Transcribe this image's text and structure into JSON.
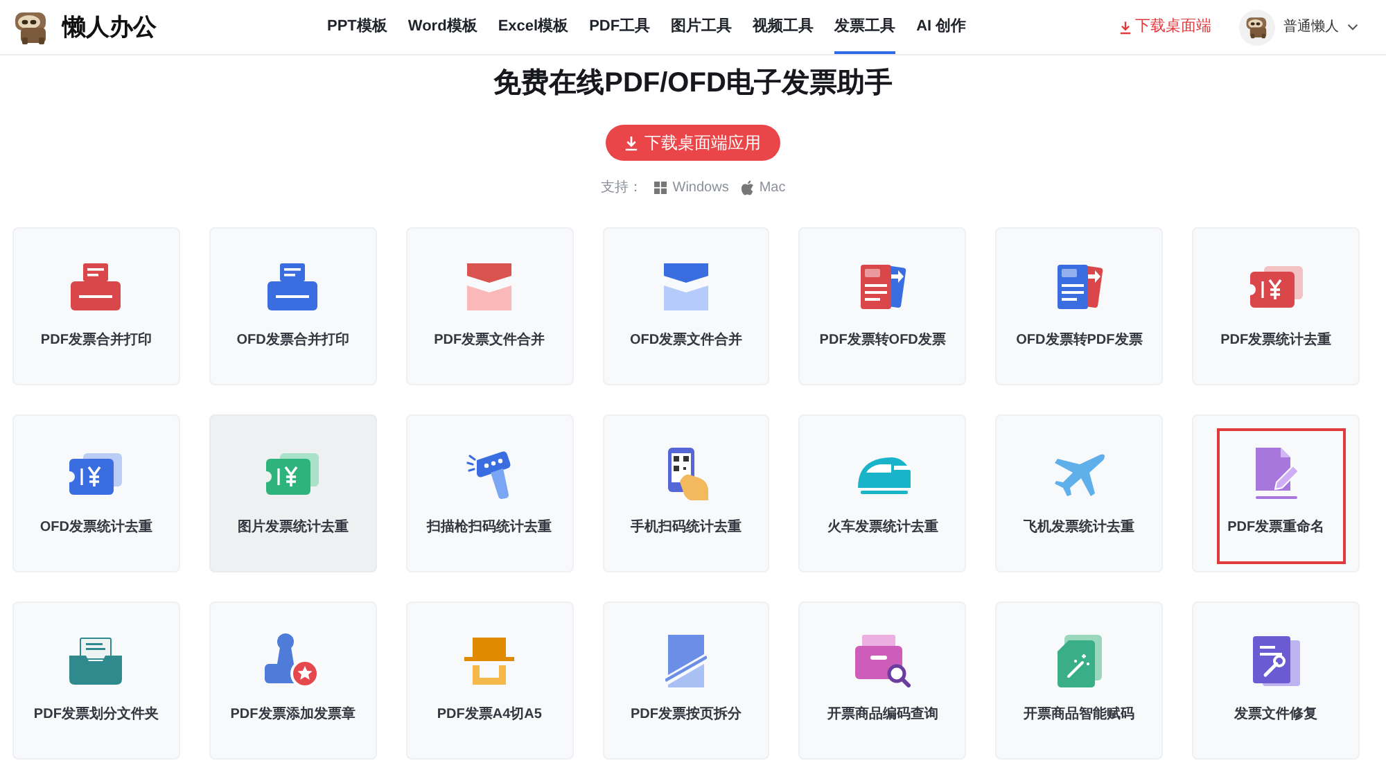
{
  "header": {
    "logo_text": "懒人办公",
    "nav": [
      {
        "label": "PPT模板",
        "selected": false
      },
      {
        "label": "Word模板",
        "selected": false
      },
      {
        "label": "Excel模板",
        "selected": false
      },
      {
        "label": "PDF工具",
        "selected": false
      },
      {
        "label": "图片工具",
        "selected": false
      },
      {
        "label": "视频工具",
        "selected": false
      },
      {
        "label": "发票工具",
        "selected": true
      },
      {
        "label": "AI 创作",
        "selected": false
      }
    ],
    "download_link": "下载桌面端",
    "user": {
      "name": "普通懒人"
    }
  },
  "hero": {
    "title": "免费在线PDF/OFD电子发票助手",
    "download_button": "下载桌面端应用",
    "support_label": "支持：",
    "platforms": [
      {
        "kind": "windows",
        "name": "Windows"
      },
      {
        "kind": "apple",
        "name": "Mac"
      }
    ]
  },
  "tools": [
    {
      "label": "PDF发票合并打印",
      "hovered": false,
      "highlighted": false
    },
    {
      "label": "OFD发票合并打印",
      "hovered": false,
      "highlighted": false
    },
    {
      "label": "PDF发票文件合并",
      "hovered": false,
      "highlighted": false
    },
    {
      "label": "OFD发票文件合并",
      "hovered": false,
      "highlighted": false
    },
    {
      "label": "PDF发票转OFD发票",
      "hovered": false,
      "highlighted": false
    },
    {
      "label": "OFD发票转PDF发票",
      "hovered": false,
      "highlighted": false
    },
    {
      "label": "PDF发票统计去重",
      "hovered": false,
      "highlighted": false
    },
    {
      "label": "OFD发票统计去重",
      "hovered": false,
      "highlighted": false
    },
    {
      "label": "图片发票统计去重",
      "hovered": true,
      "highlighted": false
    },
    {
      "label": "扫描枪扫码统计去重",
      "hovered": false,
      "highlighted": false
    },
    {
      "label": "手机扫码统计去重",
      "hovered": false,
      "highlighted": false
    },
    {
      "label": "火车发票统计去重",
      "hovered": false,
      "highlighted": false
    },
    {
      "label": "飞机发票统计去重",
      "hovered": false,
      "highlighted": false
    },
    {
      "label": "PDF发票重命名",
      "hovered": false,
      "highlighted": true
    },
    {
      "label": "PDF发票划分文件夹",
      "hovered": false,
      "highlighted": false
    },
    {
      "label": "PDF发票添加发票章",
      "hovered": false,
      "highlighted": false
    },
    {
      "label": "PDF发票A4切A5",
      "hovered": false,
      "highlighted": false
    },
    {
      "label": "PDF发票按页拆分",
      "hovered": false,
      "highlighted": false
    },
    {
      "label": "开票商品编码查询",
      "hovered": false,
      "highlighted": false
    },
    {
      "label": "开票商品智能赋码",
      "hovered": false,
      "highlighted": false
    },
    {
      "label": "发票文件修复",
      "hovered": false,
      "highlighted": false
    }
  ]
}
